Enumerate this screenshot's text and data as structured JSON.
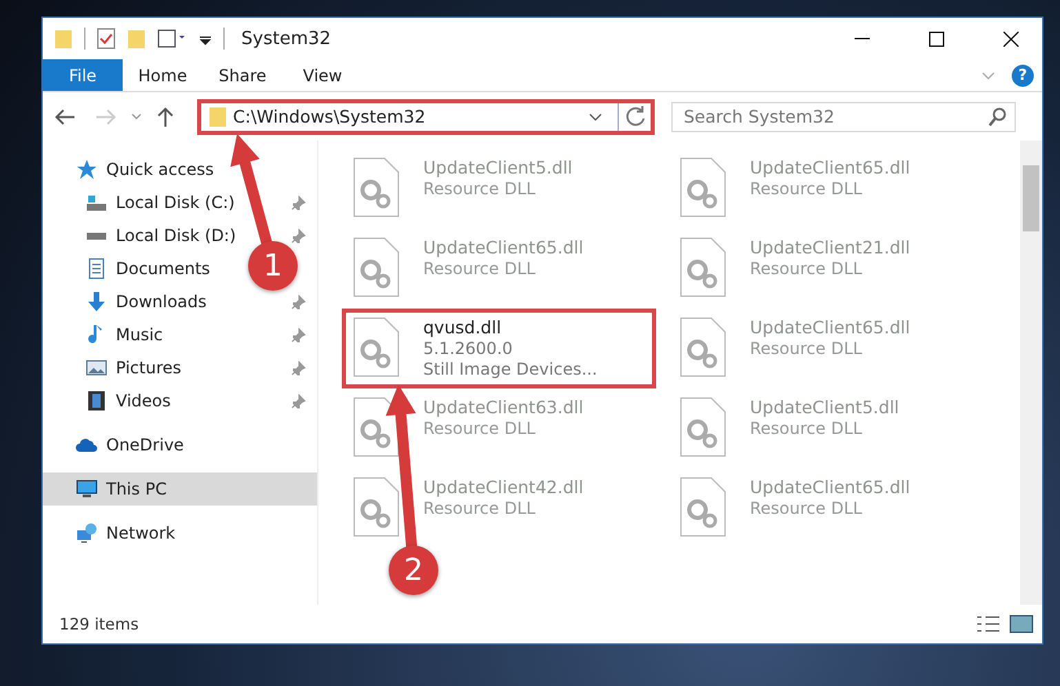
{
  "window": {
    "title": "System32"
  },
  "ribbon": {
    "tabs": [
      {
        "label": "File",
        "selected": true
      },
      {
        "label": "Home",
        "selected": false
      },
      {
        "label": "Share",
        "selected": false
      },
      {
        "label": "View",
        "selected": false
      }
    ],
    "help": "?"
  },
  "address": {
    "path": "C:\\Windows\\System32",
    "highlighted": true
  },
  "search": {
    "placeholder": "Search System32"
  },
  "sidebar": {
    "items": [
      {
        "label": "Quick access",
        "selected": false,
        "children": [
          {
            "label": "Local Disk (C:)",
            "pinned": true
          },
          {
            "label": "Local Disk (D:)",
            "pinned": true
          },
          {
            "label": "Documents",
            "pinned": false
          },
          {
            "label": "Downloads",
            "pinned": true
          },
          {
            "label": "Music",
            "pinned": true
          },
          {
            "label": "Pictures",
            "pinned": true
          },
          {
            "label": "Videos",
            "pinned": true
          }
        ]
      },
      {
        "label": "OneDrive",
        "selected": false
      },
      {
        "label": "This PC",
        "selected": true
      },
      {
        "label": "Network",
        "selected": false
      }
    ]
  },
  "files": [
    {
      "name": "UpdateClient5.dll",
      "details": [
        "Resource DLL"
      ],
      "highlighted": false
    },
    {
      "name": "UpdateClient65.dll",
      "details": [
        "Resource DLL"
      ],
      "highlighted": false
    },
    {
      "name": "UpdateClient65.dll",
      "details": [
        "Resource DLL"
      ],
      "highlighted": false
    },
    {
      "name": "UpdateClient21.dll",
      "details": [
        "Resource DLL"
      ],
      "highlighted": false
    },
    {
      "name": "qvusd.dll",
      "details": [
        "5.1.2600.0",
        "Still Image Devices..."
      ],
      "highlighted": true
    },
    {
      "name": "UpdateClient65.dll",
      "details": [
        "Resource DLL"
      ],
      "highlighted": false
    },
    {
      "name": "UpdateClient63.dll",
      "details": [
        "Resource DLL"
      ],
      "highlighted": false
    },
    {
      "name": "UpdateClient5.dll",
      "details": [
        "Resource DLL"
      ],
      "highlighted": false
    },
    {
      "name": "UpdateClient42.dll",
      "details": [
        "Resource DLL"
      ],
      "highlighted": false
    },
    {
      "name": "UpdateClient65.dll",
      "details": [
        "Resource DLL"
      ],
      "highlighted": false
    }
  ],
  "status_bar": {
    "count": "129 items"
  },
  "annotations": [
    {
      "number": "1"
    },
    {
      "number": "2"
    }
  ]
}
